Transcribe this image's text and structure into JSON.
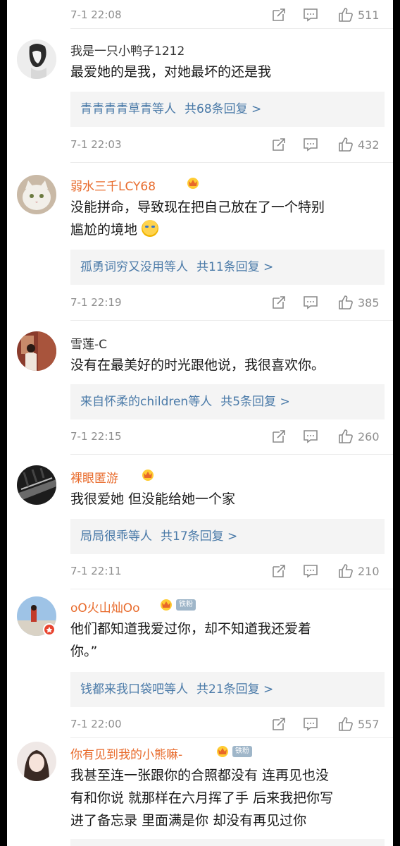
{
  "top_meta": {
    "time": "7-1 22:08",
    "likes": "511"
  },
  "comments": [
    {
      "username": "我是一只小鸭子1212",
      "text_lines": [
        "最爱她的是我，对她最坏的还是我"
      ],
      "replies_names": "青青青青草青等人",
      "replies_count": "共68条回复 >",
      "time": "7-1 22:03",
      "likes": "432"
    },
    {
      "username": "弱水三千LCY68",
      "text_lines": [
        "没能拼命，导致现在把自己放在了一个特别",
        "尴尬的境地"
      ],
      "replies_names": "孤勇词穷又没用等人",
      "replies_count": "共11条回复 >",
      "time": "7-1 22:19",
      "likes": "385"
    },
    {
      "username": "雪莲-C",
      "text_lines": [
        "没有在最美好的时光跟他说，我很喜欢你。"
      ],
      "replies_names": "来自怀柔的children等人",
      "replies_count": "共5条回复 >",
      "time": "7-1 22:15",
      "likes": "260"
    },
    {
      "username": "裸眼匿游",
      "text_lines": [
        "我很爱她 但没能给她一个家"
      ],
      "replies_names": "局局很乖等人",
      "replies_count": "共17条回复 >",
      "time": "7-1 22:11",
      "likes": "210"
    },
    {
      "username": "oO火山灿Oo",
      "fan_badge": "铁粉",
      "text_lines": [
        "他们都知道我爱过你，却不知道我还爱着",
        "你。”"
      ],
      "replies_names": "钱都来我口袋吧等人",
      "replies_count": "共21条回复 >",
      "time": "7-1 22:00",
      "likes": "557"
    },
    {
      "username": "你有见到我的小熊嘛-",
      "fan_badge": "铁粉",
      "text_lines": [
        "我甚至连一张跟你的合照都没有 连再见也没",
        "有和你说 就那样在六月挥了手 后来我把你写",
        "进了备忘录 里面满是你 却没有再见过你"
      ]
    }
  ],
  "colors": {
    "link_blue": "#4a7aa8",
    "vip_orange": "#e86b2c",
    "meta_gray": "#8e8e8e",
    "reply_bg": "#f4f4f4"
  },
  "icons": [
    "repost-icon",
    "comment-icon",
    "like-icon",
    "crown-badge-icon",
    "emoji-icon"
  ]
}
